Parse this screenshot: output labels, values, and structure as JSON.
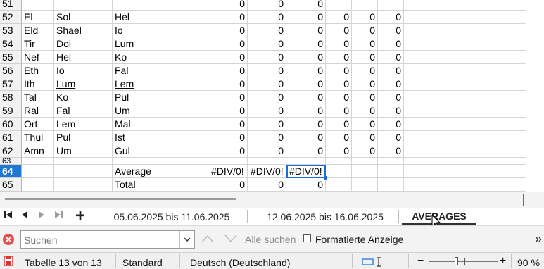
{
  "sheet": {
    "rows": [
      {
        "n": "51",
        "a": "",
        "b": "",
        "c": "",
        "d": "0",
        "e": "0",
        "f": "0",
        "g": "",
        "h": "",
        "i": ""
      },
      {
        "n": "52",
        "a": "El",
        "b": "Sol",
        "c": "Hel",
        "d": "0",
        "e": "0",
        "f": "0",
        "g": "0",
        "h": "0",
        "i": "0"
      },
      {
        "n": "53",
        "a": "Eld",
        "b": "Shael",
        "c": "Io",
        "d": "0",
        "e": "0",
        "f": "0",
        "g": "0",
        "h": "0",
        "i": "0"
      },
      {
        "n": "54",
        "a": "Tir",
        "b": "Dol",
        "c": "Lum",
        "d": "0",
        "e": "0",
        "f": "0",
        "g": "0",
        "h": "0",
        "i": "0"
      },
      {
        "n": "55",
        "a": "Nef",
        "b": "Hel",
        "c": "Ko",
        "d": "0",
        "e": "0",
        "f": "0",
        "g": "0",
        "h": "0",
        "i": "0"
      },
      {
        "n": "56",
        "a": "Eth",
        "b": "Io",
        "c": "Fal",
        "d": "0",
        "e": "0",
        "f": "0",
        "g": "0",
        "h": "0",
        "i": "0"
      },
      {
        "n": "57",
        "a": "Ith",
        "b": "Lum",
        "c": "Lem",
        "d": "0",
        "e": "0",
        "f": "0",
        "g": "0",
        "h": "0",
        "i": "0"
      },
      {
        "n": "58",
        "a": "Tal",
        "b": "Ko",
        "c": "Pul",
        "d": "0",
        "e": "0",
        "f": "0",
        "g": "0",
        "h": "0",
        "i": "0"
      },
      {
        "n": "59",
        "a": "Ral",
        "b": "Fal",
        "c": "Um",
        "d": "0",
        "e": "0",
        "f": "0",
        "g": "0",
        "h": "0",
        "i": "0"
      },
      {
        "n": "60",
        "a": "Ort",
        "b": "Lem",
        "c": "Mal",
        "d": "0",
        "e": "0",
        "f": "0",
        "g": "0",
        "h": "0",
        "i": "0"
      },
      {
        "n": "61",
        "a": "Thul",
        "b": "Pul",
        "c": "Ist",
        "d": "0",
        "e": "0",
        "f": "0",
        "g": "0",
        "h": "0",
        "i": "0"
      },
      {
        "n": "62",
        "a": "Amn",
        "b": "Um",
        "c": "Gul",
        "d": "0",
        "e": "0",
        "f": "0",
        "g": "0",
        "h": "0",
        "i": "0"
      },
      {
        "n": "63",
        "a": "",
        "b": "",
        "c": "",
        "d": "",
        "e": "",
        "f": "",
        "g": "",
        "h": "",
        "i": ""
      },
      {
        "n": "64",
        "a": "",
        "b": "",
        "c": "Average",
        "d": "#DIV/0!",
        "e": "#DIV/0!",
        "f": "#DIV/0!",
        "g": "",
        "h": "",
        "i": ""
      },
      {
        "n": "65",
        "a": "",
        "b": "",
        "c": "Total",
        "d": "0",
        "e": "0",
        "f": "0",
        "g": "",
        "h": "",
        "i": ""
      }
    ]
  },
  "tabs": {
    "items": [
      "05.06.2025 bis 11.06.2025",
      "12.06.2025 bis 16.06.2025",
      "AVERAGES"
    ],
    "add_label": "+"
  },
  "find": {
    "placeholder": "Suchen",
    "find_all": "Alle suchen",
    "formatted_display": "Formatierte Anzeige",
    "more": "»"
  },
  "status": {
    "sheet_info": "Tabelle 13 von 13",
    "page_style": "Standard",
    "language": "Deutsch (Deutschland)",
    "zoom_minus": "−",
    "zoom_plus": "+",
    "zoom": "90 %"
  },
  "colors": {
    "selection": "#1f78d1",
    "error_close": "#e05252"
  }
}
